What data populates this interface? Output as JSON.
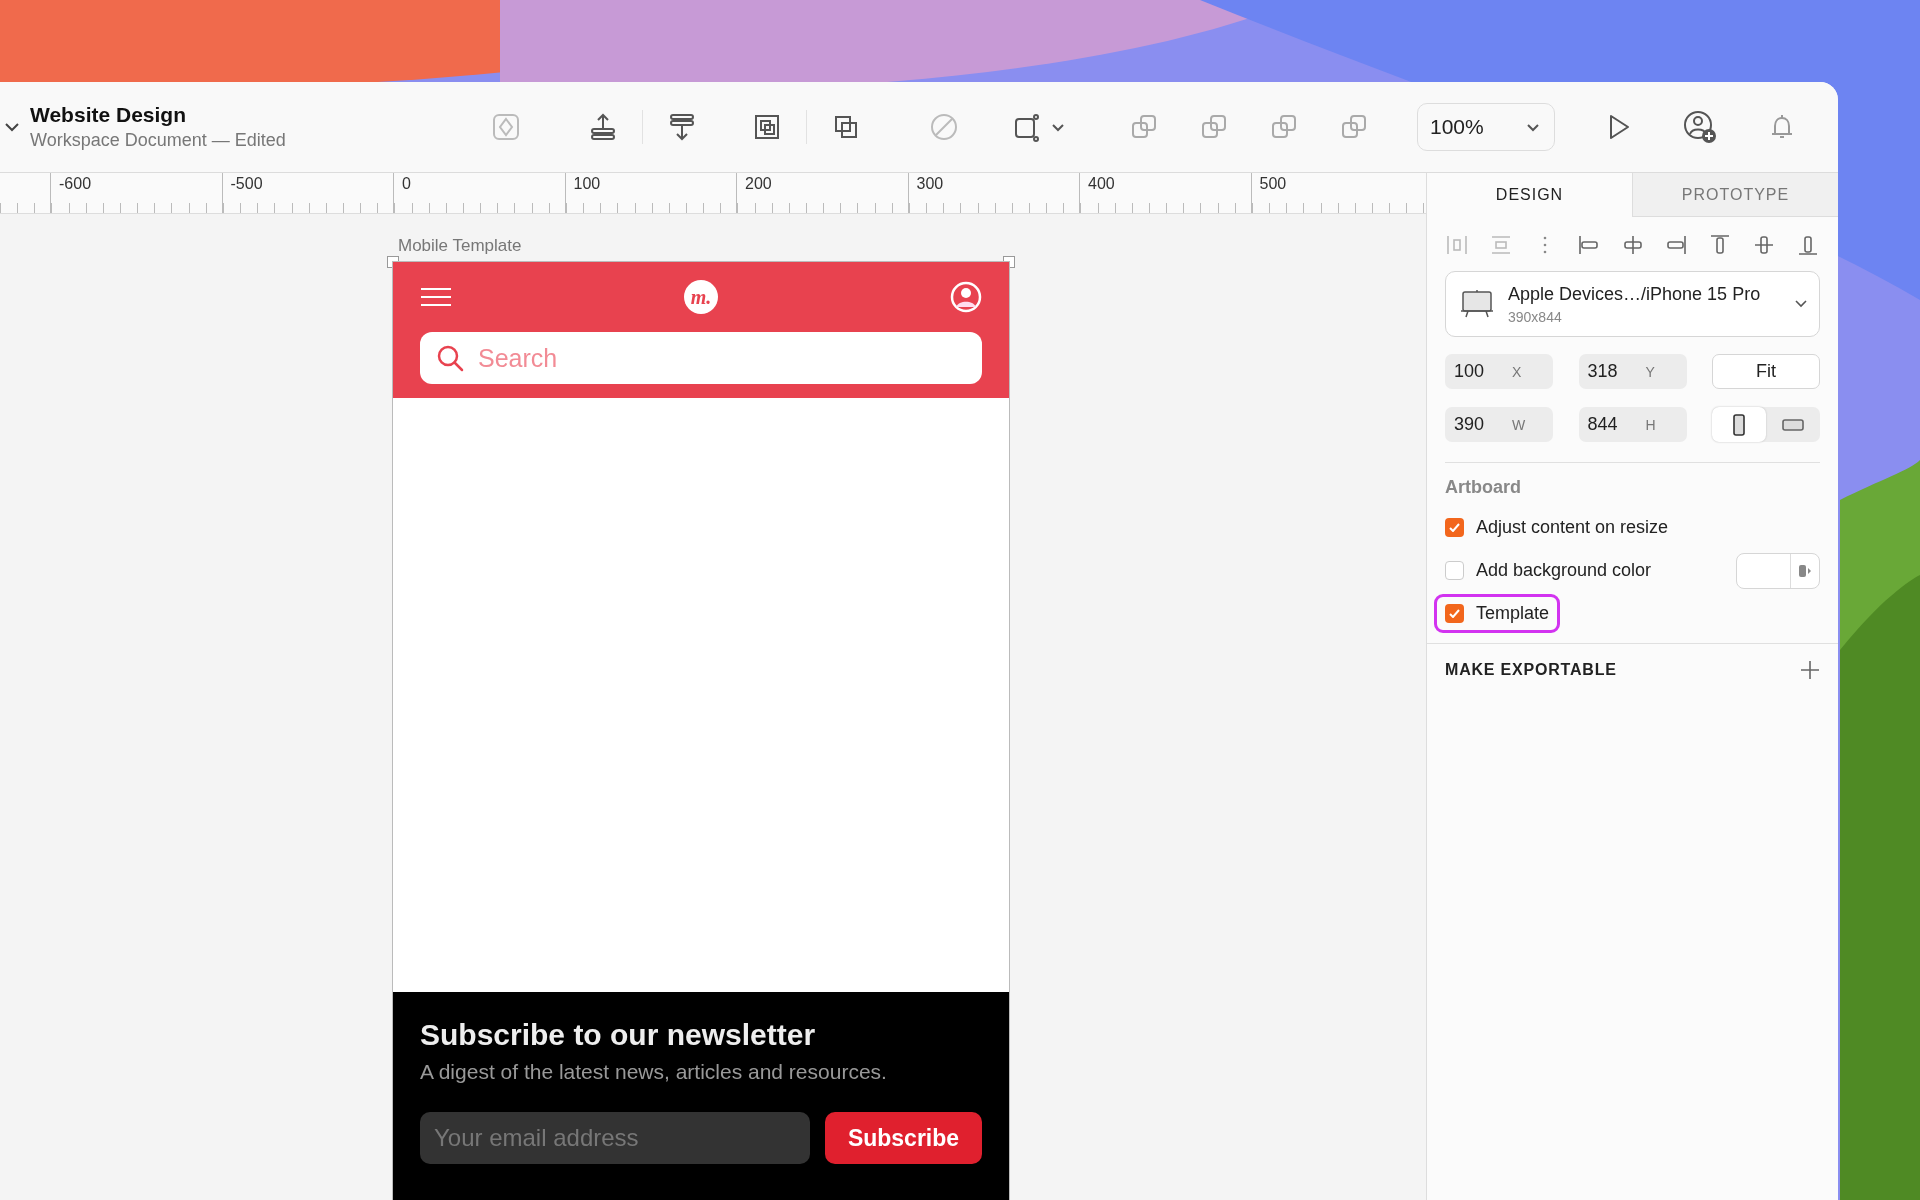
{
  "window": {
    "title": "Website Design",
    "subtitle": "Workspace Document — Edited"
  },
  "toolbar": {
    "zoom": "100%"
  },
  "ruler": {
    "labels": [
      "-600",
      "-500",
      "0",
      "100",
      "200",
      "300",
      "400",
      "500"
    ]
  },
  "artboard": {
    "name": "Mobile Template",
    "logo": "m.",
    "search": {
      "placeholder": "Search"
    },
    "newsletter": {
      "title": "Subscribe to our newsletter",
      "text": "A digest of the latest news, articles and resources.",
      "email": {
        "placeholder": "Your email address"
      },
      "button": "Subscribe"
    }
  },
  "inspector": {
    "tabs": [
      {
        "label": "DESIGN",
        "selected": true
      },
      {
        "label": "PROTOTYPE",
        "selected": false
      }
    ],
    "device": {
      "name": "Apple Devices…/iPhone 15 Pro",
      "size": "390x844"
    },
    "fields": [
      {
        "value": "100",
        "label": "X"
      },
      {
        "value": "318",
        "label": "Y"
      },
      {
        "value": "390",
        "label": "W"
      },
      {
        "value": "844",
        "label": "H"
      }
    ],
    "fit": "Fit",
    "orientation": [
      {
        "kind": "portrait",
        "selected": true
      },
      {
        "kind": "landscape",
        "selected": false
      }
    ],
    "section": "Artboard",
    "options": [
      {
        "kind": "checkbox",
        "label": "Adjust content on resize",
        "checked": true,
        "highlighted": false
      },
      {
        "kind": "color",
        "label": "Add background color",
        "checked": false,
        "highlighted": false
      },
      {
        "kind": "checkbox",
        "label": "Template",
        "checked": true,
        "highlighted": true
      }
    ],
    "export": "MAKE EXPORTABLE"
  }
}
